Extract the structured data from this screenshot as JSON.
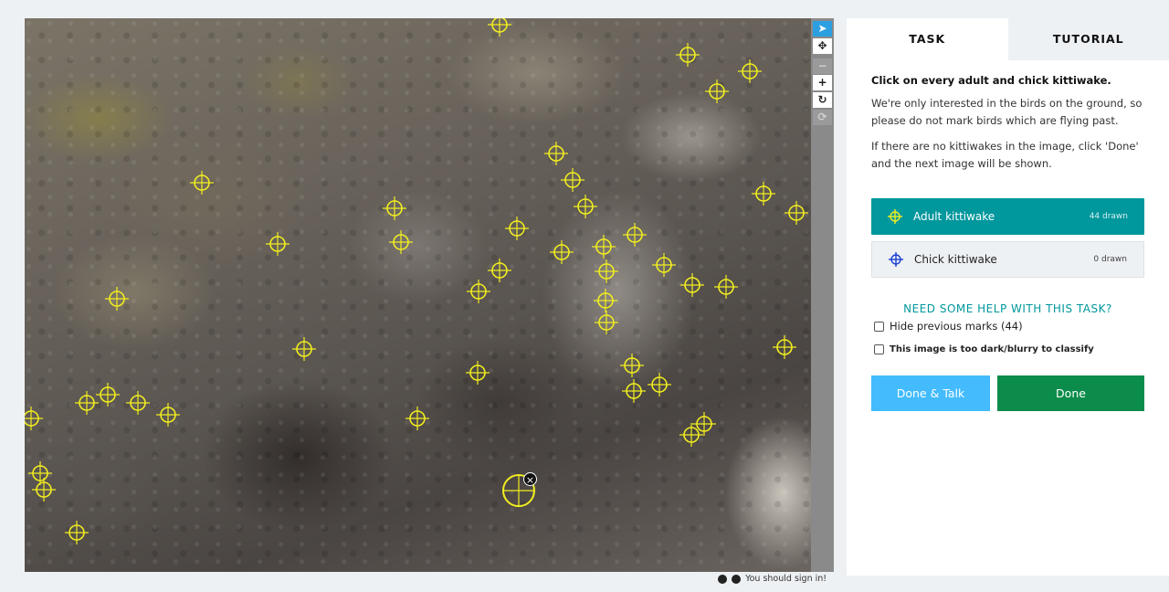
{
  "colors": {
    "mark_yellow": "#f2ee1f",
    "adult_tool_bg": "#00979d",
    "done_talk_bg": "#43bbfd",
    "done_bg": "#0c8c4a",
    "toolbar_active": "#2b9fe0"
  },
  "toolbar": {
    "items": [
      {
        "name": "pointer-icon",
        "glyph": "➤",
        "state": "active"
      },
      {
        "name": "pan-icon",
        "glyph": "✥",
        "state": "normal"
      },
      {
        "name": "zoom-out-icon",
        "glyph": "−",
        "state": "disabled"
      },
      {
        "name": "zoom-in-icon",
        "glyph": "+",
        "state": "normal"
      },
      {
        "name": "rotate-icon",
        "glyph": "↻",
        "state": "normal"
      },
      {
        "name": "reset-icon",
        "glyph": "⟳",
        "state": "disabled"
      }
    ]
  },
  "footer": {
    "contrast_icon": "half-circle-icon",
    "info_icon": "info-icon",
    "sign_in_text": "You should sign in!"
  },
  "tabs": [
    {
      "label": "TASK",
      "active": true
    },
    {
      "label": "TUTORIAL",
      "active": false
    }
  ],
  "task": {
    "question": "Click on every adult and chick kittiwake.",
    "instructions": [
      "We're only interested in the birds on the ground, so please do not mark birds which are flying past.",
      "If there are no kittiwakes in the image, click 'Done' and the next image will be shown."
    ],
    "tools": [
      {
        "label": "Adult kittiwake",
        "count": "44 drawn",
        "icon": "crosshair-icon",
        "icon_color": "#f2ee1f"
      },
      {
        "label": "Chick kittiwake",
        "count": "0 drawn",
        "icon": "crosshair-icon",
        "icon_color": "#1a3fd1"
      }
    ],
    "help_link": "NEED SOME HELP WITH THIS TASK?",
    "hide_marks_label": "Hide previous marks (44)",
    "too_dark_label": "This image is too dark/blurry to classify",
    "done_talk_label": "Done & Talk",
    "done_label": "Done"
  }
}
